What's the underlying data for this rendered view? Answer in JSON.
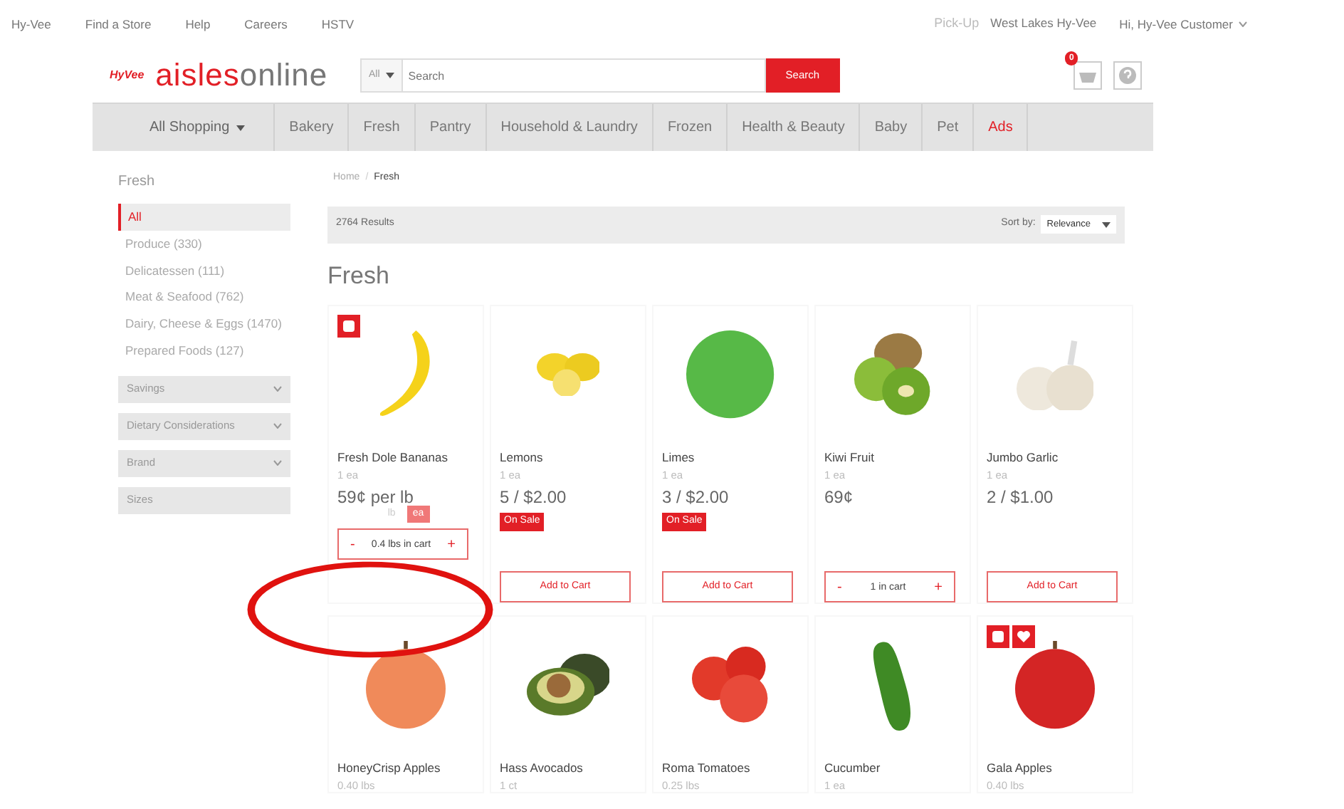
{
  "top_links": [
    "Hy-Vee",
    "Find a Store",
    "Help",
    "Careers",
    "HSTV"
  ],
  "pickup": {
    "label": "Pick-Up",
    "store": "West Lakes Hy-Vee"
  },
  "account": "Hi, Hy-Vee Customer",
  "logo": {
    "brand": "HyVee",
    "name_bold": "aisles",
    "name_light": "online"
  },
  "search": {
    "scope": "All",
    "placeholder": "Search",
    "button": "Search"
  },
  "cart_count": "0",
  "nav": [
    {
      "label": "All Shopping",
      "dropdown": true,
      "selected": false
    },
    {
      "label": "Bakery",
      "dropdown": false,
      "selected": false
    },
    {
      "label": "Fresh",
      "dropdown": false,
      "selected": false
    },
    {
      "label": "Pantry",
      "dropdown": false,
      "selected": false
    },
    {
      "label": "Household & Laundry",
      "dropdown": false,
      "selected": false
    },
    {
      "label": "Frozen",
      "dropdown": false,
      "selected": false
    },
    {
      "label": "Health & Beauty",
      "dropdown": false,
      "selected": false
    },
    {
      "label": "Baby",
      "dropdown": false,
      "selected": false
    },
    {
      "label": "Pet",
      "dropdown": false,
      "selected": false
    },
    {
      "label": "Ads",
      "dropdown": false,
      "selected": true
    }
  ],
  "sidebar": {
    "title": "Fresh",
    "categories": [
      {
        "label": "All",
        "selected": true
      },
      {
        "label": "Produce (330)",
        "selected": false
      },
      {
        "label": "Delicatessen (111)",
        "selected": false
      },
      {
        "label": "Meat & Seafood (762)",
        "selected": false
      },
      {
        "label": "Dairy, Cheese & Eggs (1470)",
        "selected": false
      },
      {
        "label": "Prepared Foods (127)",
        "selected": false
      }
    ],
    "filters": [
      {
        "label": "Savings",
        "expandable": true
      },
      {
        "label": "Dietary Considerations",
        "expandable": true
      },
      {
        "label": "Brand",
        "expandable": true
      },
      {
        "label": "Sizes",
        "expandable": false
      }
    ]
  },
  "breadcrumb": {
    "items": [
      "Home",
      "Fresh"
    ],
    "separator": "/"
  },
  "results": {
    "count": "2764 Results",
    "sort_label": "Sort by:",
    "sort_value": "Relevance"
  },
  "heading": "Fresh",
  "products": [
    {
      "name": "Fresh Dole Bananas",
      "size": "1 ea",
      "price": "59¢ per lb",
      "kind": "banana",
      "flags": [
        {
          "kind": "note"
        }
      ],
      "units": [
        {
          "label": "lb",
          "selected": false
        },
        {
          "label": "ea",
          "selected": true
        }
      ],
      "cart": {
        "kind": "qty",
        "minus": "-",
        "text": "0.4 lbs in cart",
        "plus": "+"
      }
    },
    {
      "name": "Lemons",
      "size": "1 ea",
      "price": "5 / $2.00",
      "kind": "lemon",
      "on_sale": "On Sale",
      "cart": {
        "kind": "add",
        "text": "Add to Cart"
      }
    },
    {
      "name": "Limes",
      "size": "1 ea",
      "price": "3 / $2.00",
      "kind": "lime",
      "on_sale": "On Sale",
      "cart": {
        "kind": "add",
        "text": "Add to Cart"
      }
    },
    {
      "name": "Kiwi Fruit",
      "size": "1 ea",
      "price": "69¢",
      "kind": "kiwi",
      "cart": {
        "kind": "qty",
        "minus": "-",
        "text": "1 in cart",
        "plus": "+"
      }
    },
    {
      "name": "Jumbo Garlic",
      "size": "1 ea",
      "price": "2 / $1.00",
      "kind": "garlic",
      "cart": {
        "kind": "add",
        "text": "Add to Cart"
      }
    },
    {
      "name": "HoneyCrisp Apples",
      "size": "0.40 lbs",
      "kind": "apple_yellow"
    },
    {
      "name": "Hass Avocados",
      "size": "1 ct",
      "kind": "avocado"
    },
    {
      "name": "Roma Tomatoes",
      "size": "0.25 lbs",
      "kind": "tomato"
    },
    {
      "name": "Cucumber",
      "size": "1 ea",
      "kind": "cucumber"
    },
    {
      "name": "Gala Apples",
      "size": "0.40 lbs",
      "kind": "apple_red",
      "flags": [
        {
          "kind": "note"
        },
        {
          "kind": "heart"
        }
      ]
    }
  ],
  "annotation": {
    "kind": "circle"
  }
}
